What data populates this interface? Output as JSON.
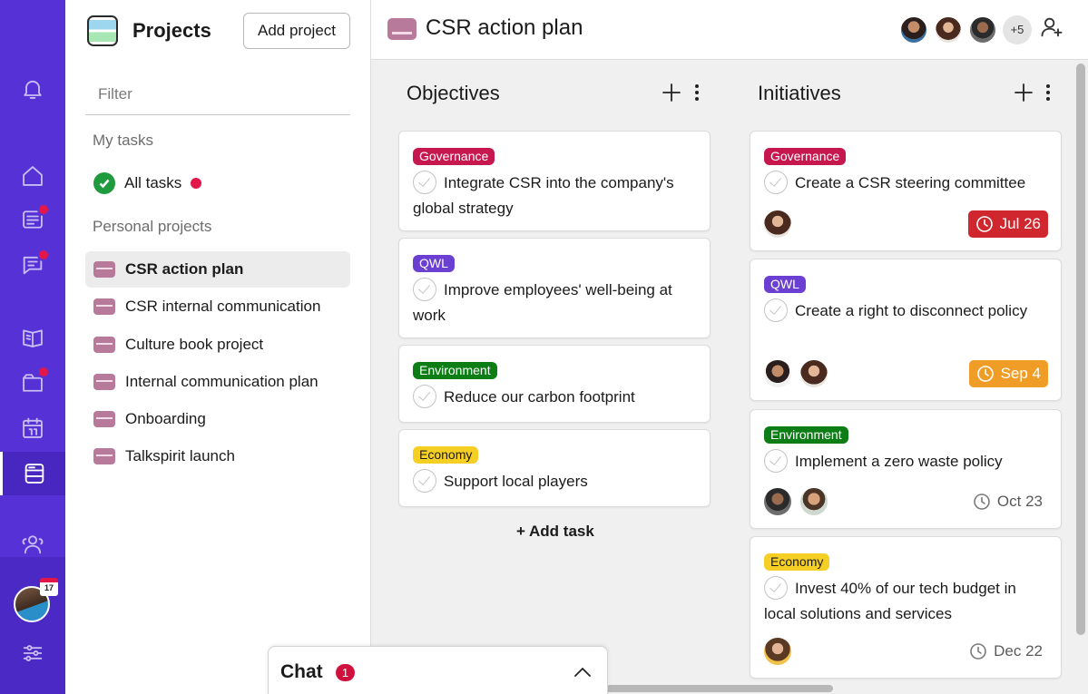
{
  "rail": {
    "items": [
      {
        "name": "notifications-bell-icon"
      },
      {
        "name": "home-icon"
      },
      {
        "name": "newsfeed-icon"
      },
      {
        "name": "chat-bubble-icon"
      },
      {
        "name": "knowledge-book-icon"
      },
      {
        "name": "folder-icon"
      },
      {
        "name": "calendar-icon"
      },
      {
        "name": "projects-icon"
      },
      {
        "name": "people-icon"
      },
      {
        "name": "settings-sliders-icon"
      }
    ],
    "calendar_badge_day": "17",
    "accent_color": "#5632d6"
  },
  "panel": {
    "title": "Projects",
    "add_project_label": "Add project",
    "filter_placeholder": "Filter",
    "my_tasks_label": "My tasks",
    "all_tasks_label": "All tasks",
    "personal_projects_label": "Personal projects",
    "projects": [
      {
        "label": "CSR action plan",
        "selected": true
      },
      {
        "label": "CSR internal communication"
      },
      {
        "label": "Culture book project"
      },
      {
        "label": "Internal communication plan"
      },
      {
        "label": "Onboarding"
      },
      {
        "label": "Talkspirit launch"
      }
    ]
  },
  "topbar": {
    "title": "CSR action plan",
    "more_members": "+5"
  },
  "board": {
    "add_task_label": "+ Add task",
    "columns": [
      {
        "title": "Objectives",
        "cards": [
          {
            "tag": "Governance",
            "text": "Integrate CSR into the company's global strategy"
          },
          {
            "tag": "QWL",
            "text": "Improve employees' well-being at work"
          },
          {
            "tag": "Environment",
            "text": "Reduce our carbon footprint"
          },
          {
            "tag": "Economy",
            "text": "Support local players"
          }
        ]
      },
      {
        "title": "Initiatives",
        "cards": [
          {
            "tag": "Governance",
            "text": "Create a CSR steering committee",
            "due": "Jul 26",
            "due_status": "overdue"
          },
          {
            "tag": "QWL",
            "text": "Create a right to disconnect policy",
            "due": "Sep 4",
            "due_status": "soon"
          },
          {
            "tag": "Environment",
            "text": "Implement a zero waste policy",
            "due": "Oct 23"
          },
          {
            "tag": "Economy",
            "text": "Invest 40% of our tech budget in local solutions and services",
            "due": "Dec 22"
          }
        ]
      }
    ]
  },
  "chat": {
    "label": "Chat",
    "unread": "1"
  },
  "colors": {
    "governance": "#c7174f",
    "qwl": "#6a3fd1",
    "environment": "#0d7d16",
    "economy": "#f5cf24",
    "overdue": "#d0262e",
    "soon": "#ef9d27"
  }
}
